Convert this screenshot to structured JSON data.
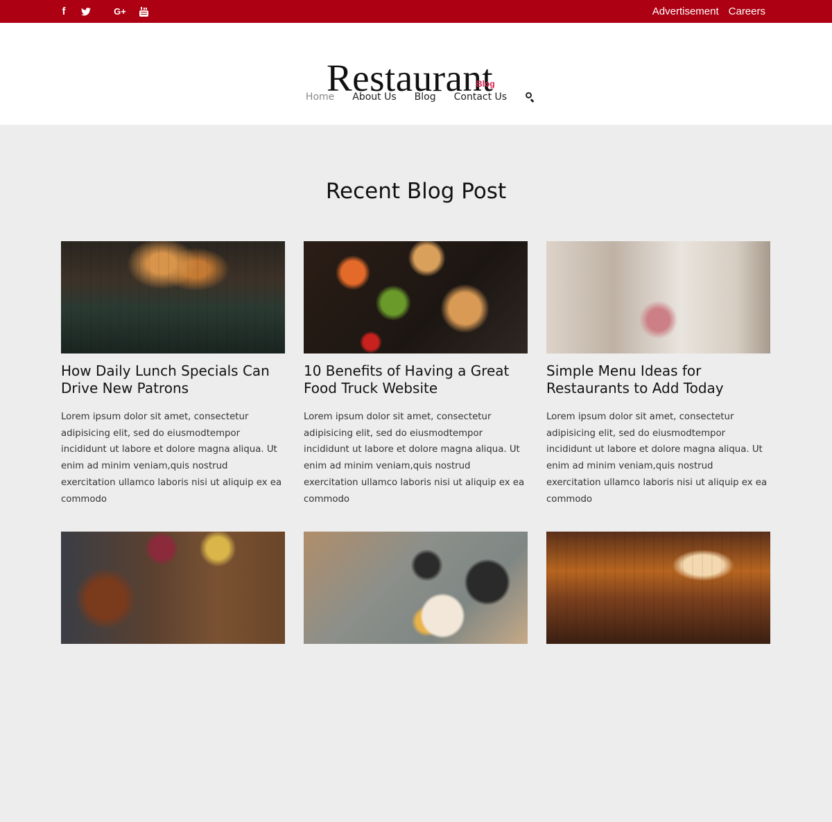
{
  "topbar": {
    "social_icons": [
      "facebook-icon",
      "twitter-icon",
      "google-plus-icon",
      "youtube-icon"
    ],
    "links": [
      "Advertisement",
      "Careers"
    ],
    "color": "#ad0013"
  },
  "header": {
    "logo_main": "Restaurant",
    "logo_sub": "Blog",
    "nav": [
      "Home",
      "About Us",
      "Blog",
      "Contact Us"
    ],
    "active_nav": "Home"
  },
  "main": {
    "section_title": "Recent Blog Post",
    "posts": [
      {
        "title": "How Daily Lunch Specials Can Drive New Patrons",
        "excerpt": "Lorem ipsum dolor sit amet, consectetur adipisicing elit, sed do eiusmodtempor incididunt ut labore et dolore magna aliqua. Ut enim ad minim veniam,quis nostrud exercitation ullamco laboris nisi ut aliquip ex ea commodo"
      },
      {
        "title": "10 Benefits of Having a Great Food Truck Website",
        "excerpt": "Lorem ipsum dolor sit amet, consectetur adipisicing elit, sed do eiusmodtempor incididunt ut labore et dolore magna aliqua. Ut enim ad minim veniam,quis nostrud exercitation ullamco laboris nisi ut aliquip ex ea commodo"
      },
      {
        "title": "Simple Menu Ideas for Restaurants to Add Today",
        "excerpt": "Lorem ipsum dolor sit amet, consectetur adipisicing elit, sed do eiusmodtempor incididunt ut labore et dolore magna aliqua. Ut enim ad minim veniam,quis nostrud exercitation ullamco laboris nisi ut aliquip ex ea commodo"
      }
    ]
  }
}
